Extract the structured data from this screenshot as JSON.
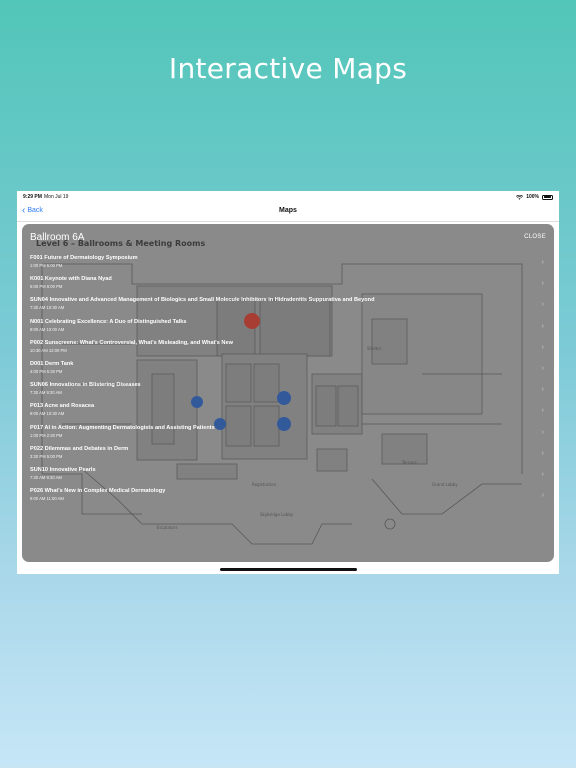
{
  "headline": "Interactive Maps",
  "status": {
    "time": "9:29 PM",
    "date": "Mon Jul 19",
    "battery": "100%"
  },
  "nav": {
    "back_label": "Back",
    "title": "Maps"
  },
  "map": {
    "room_title": "Ballroom 6A",
    "close_label": "CLOSE",
    "plan_label": "Level 6 – Ballrooms & Meeting Rooms",
    "marker_colors": {
      "highlight": "#c0392b",
      "session": "#2a5db0"
    }
  },
  "sessions": [
    {
      "title": "F001  Future of Dermatology Symposium",
      "time": "1:00 PM   5:00 PM"
    },
    {
      "title": "K001  Keynote with Diana Nyad",
      "time": "5:00 PM   6:00 PM"
    },
    {
      "title": "SUN04  Innovative and Advanced Management of Biologics and Small Molecule Inhibitors in Hidradenitis Suppurativa and Beyond",
      "time": "7:30 AM   10:30 AM"
    },
    {
      "title": "N001  Celebrating Excellence: A Duo of Distinguished Talks",
      "time": "9:00 AM   10:00 AM"
    },
    {
      "title": "P002  Sunscreens:  What's Controversial, What's Misleading, and What's New",
      "time": "10:30 AM   12:00 PM"
    },
    {
      "title": "D001  Derm Tank",
      "time": "4:00 PM   5:30 PM"
    },
    {
      "title": "SUN06  Innovations in Blistering Diseases",
      "time": "7:30 AM   9:30 AM"
    },
    {
      "title": "P013  Acne and Rosacea",
      "time": "9:00 AM   10:30 AM"
    },
    {
      "title": "P017  AI in Action: Augmenting Dermatologists and Assisting Patients",
      "time": "1:00 PM   2:30 PM"
    },
    {
      "title": "P022  Dilemmas and Debates in Derm",
      "time": "3:30 PM   5:00 PM"
    },
    {
      "title": "SUN10  Innovative Pearls",
      "time": "7:30 AM   9:30 AM"
    },
    {
      "title": "P026  What's New in Complex Medical Dermatology",
      "time": "9:00 AM   11:00 AM"
    }
  ]
}
